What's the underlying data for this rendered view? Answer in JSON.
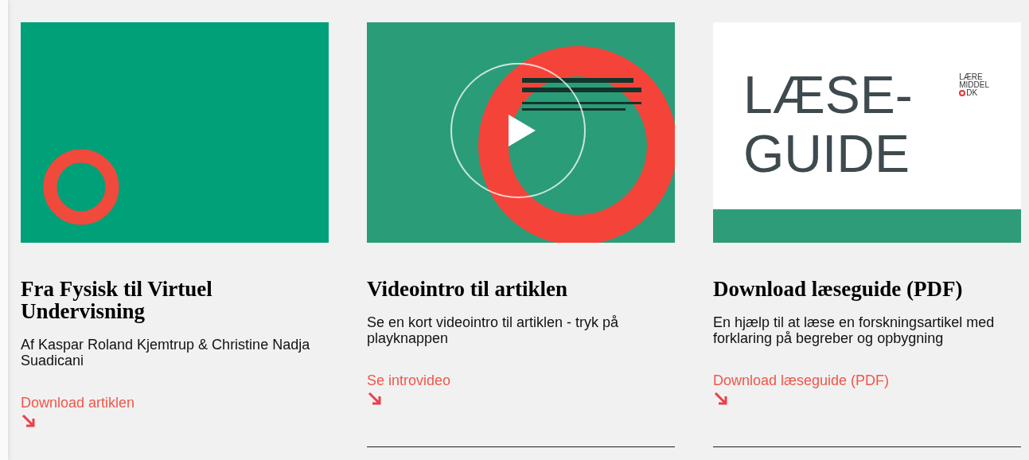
{
  "cards": [
    {
      "title": "Fra Fysisk til Virtuel Undervisning",
      "text": "Af Kaspar Roland Kjemtrup & Christine Nadja Suadicani",
      "link": "Download artiklen"
    },
    {
      "media": {
        "kind": "video"
      },
      "title": "Videointro til artiklen",
      "text": "Se en kort videointro til artiklen - tryk på playknappen",
      "link": "Se introvideo"
    },
    {
      "media": {
        "kind": "cover",
        "heading_lines": [
          "LÆSE-",
          "GUIDE"
        ],
        "logo_lines": [
          "LÆRE",
          "MIDDEL",
          "DK"
        ]
      },
      "title": "Download læseguide (PDF)",
      "text": "En hjælp til at læse en forskningsartikel med forklaring på begreber og opbygning",
      "link": "Download læseguide (PDF)"
    }
  ]
}
